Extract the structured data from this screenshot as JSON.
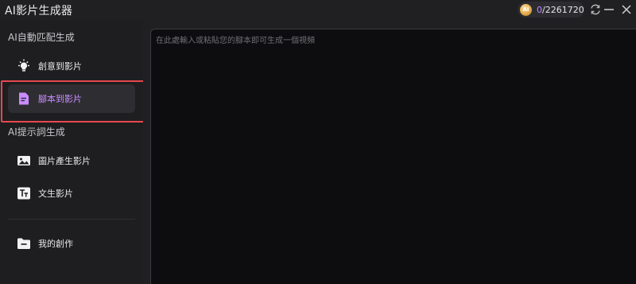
{
  "app": {
    "title": "AI影片生成器"
  },
  "header": {
    "coin_label": "AI",
    "credits_used": "0",
    "credits_total": "/2261720"
  },
  "sidebar": {
    "section1_title": "AI自動匹配生成",
    "section2_title": "AI提示詞生成",
    "items": [
      {
        "label": "創意到影片",
        "icon": "lightbulb-icon"
      },
      {
        "label": "腳本到影片",
        "icon": "script-document-icon",
        "active": true
      },
      {
        "label": "圖片產生影片",
        "icon": "image-icon"
      },
      {
        "label": "文生影片",
        "icon": "text-tt-icon"
      },
      {
        "label": "我的創作",
        "icon": "folder-icon"
      }
    ]
  },
  "editor": {
    "placeholder": "在此處輸入或粘貼您的腳本即可生成一個視頻",
    "value": ""
  },
  "colors": {
    "accent": "#c98cff",
    "highlight": "#e5484d",
    "background": "#1e1e20",
    "editor_bg": "#0d0d0f"
  }
}
